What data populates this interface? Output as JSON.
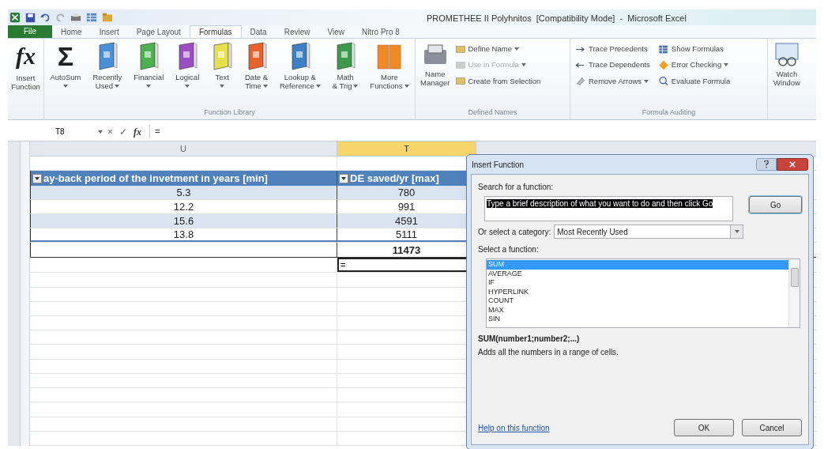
{
  "window": {
    "title": "PROMETHEE II Polyhnitos  [Compatibility Mode]  -  Microsoft Excel"
  },
  "tabs": [
    {
      "label": "File",
      "kind": "file",
      "selected": false
    },
    {
      "label": "Home",
      "kind": "tab",
      "selected": false
    },
    {
      "label": "Insert",
      "kind": "tab",
      "selected": false
    },
    {
      "label": "Page Layout",
      "kind": "tab",
      "selected": false
    },
    {
      "label": "Formulas",
      "kind": "tab",
      "selected": true
    },
    {
      "label": "Data",
      "kind": "tab",
      "selected": false
    },
    {
      "label": "Review",
      "kind": "tab",
      "selected": false
    },
    {
      "label": "View",
      "kind": "tab",
      "selected": false
    },
    {
      "label": "Nitro Pro 8",
      "kind": "tab",
      "selected": false
    }
  ],
  "ribbon": {
    "insert_function": {
      "glyph": "fx",
      "label": "Insert Function"
    },
    "function_library": {
      "label": "Function Library",
      "buttons": [
        {
          "kind": "sigma",
          "glyph": "Σ",
          "lines": [
            "AutoSum"
          ],
          "dropdown": true
        },
        {
          "kind": "book",
          "color": "#4a90d9",
          "lines": [
            "Recently",
            "Used"
          ],
          "dropdown": true
        },
        {
          "kind": "book",
          "color": "#4caf50",
          "lines": [
            "Financial"
          ],
          "dropdown": true
        },
        {
          "kind": "book",
          "color": "#9c4dc4",
          "lines": [
            "Logical"
          ],
          "dropdown": true
        },
        {
          "kind": "book",
          "color": "#e6e04a",
          "lines": [
            "Text"
          ],
          "dropdown": true
        },
        {
          "kind": "book",
          "color": "#e8632b",
          "lines": [
            "Date &",
            "Time"
          ],
          "dropdown": true
        },
        {
          "kind": "book",
          "color": "#3f7fc4",
          "lines": [
            "Lookup &",
            "Reference"
          ],
          "dropdown": true
        },
        {
          "kind": "book",
          "color": "#3d9a4a",
          "lines": [
            "Math",
            "& Trig"
          ],
          "dropdown": true
        },
        {
          "kind": "books",
          "color": "#f08a24",
          "lines": [
            "More",
            "Functions"
          ],
          "dropdown": true
        }
      ]
    },
    "defined_names": {
      "label": "Defined Names",
      "manager": [
        "Name",
        "Manager"
      ],
      "items": [
        {
          "label": "Define Name",
          "dropdown": true,
          "disabled": false
        },
        {
          "label": "Use in Formula",
          "dropdown": true,
          "disabled": true
        },
        {
          "label": "Create from Selection",
          "dropdown": false,
          "disabled": false
        }
      ]
    },
    "formula_auditing": {
      "label": "Formula Auditing",
      "columns": [
        [
          {
            "label": "Trace Precedents",
            "dropdown": false
          },
          {
            "label": "Trace Dependents",
            "dropdown": false
          },
          {
            "label": "Remove Arrows",
            "dropdown": true
          }
        ],
        [
          {
            "label": "Show Formulas",
            "dropdown": false
          },
          {
            "label": "Error Checking",
            "dropdown": true
          },
          {
            "label": "Evaluate Formula",
            "dropdown": false
          }
        ]
      ]
    },
    "watch_window": [
      "Watch",
      "Window"
    ]
  },
  "formula_bar": {
    "name_box": "T8",
    "buttons": [
      "×",
      "✓",
      "fx"
    ],
    "formula": "="
  },
  "sheet": {
    "columns": [
      {
        "label": "U",
        "selected": false
      },
      {
        "label": "T",
        "selected": true
      }
    ],
    "headers": [
      "ay-back period of the invetment in years [min]",
      "DE saved/yr [max]"
    ],
    "rows": [
      [
        "5.3",
        "780"
      ],
      [
        "12.2",
        "991"
      ],
      [
        "15.6",
        "4591"
      ],
      [
        "13.8",
        "5111"
      ]
    ],
    "total_value": "11473",
    "active_cell": "="
  },
  "dialog": {
    "title": "Insert Function",
    "search_label": "Search for a function:",
    "search_value": "Type a brief description of what you want to do and then click Go",
    "search_highlighted": true,
    "go": "Go",
    "category_label": "Or select a category:",
    "category": "Most Recently Used",
    "function_label": "Select a function:",
    "functions": [
      {
        "label": "SUM",
        "selected": true
      },
      {
        "label": "AVERAGE",
        "selected": false
      },
      {
        "label": "IF",
        "selected": false
      },
      {
        "label": "HYPERLINK",
        "selected": false
      },
      {
        "label": "COUNT",
        "selected": false
      },
      {
        "label": "MAX",
        "selected": false
      },
      {
        "label": "SIN",
        "selected": false
      }
    ],
    "signature": "SUM(number1;number2;...)",
    "description": "Adds all the numbers in a range of cells.",
    "help_link": "Help on this function",
    "buttons": [
      "OK",
      "Cancel"
    ]
  }
}
